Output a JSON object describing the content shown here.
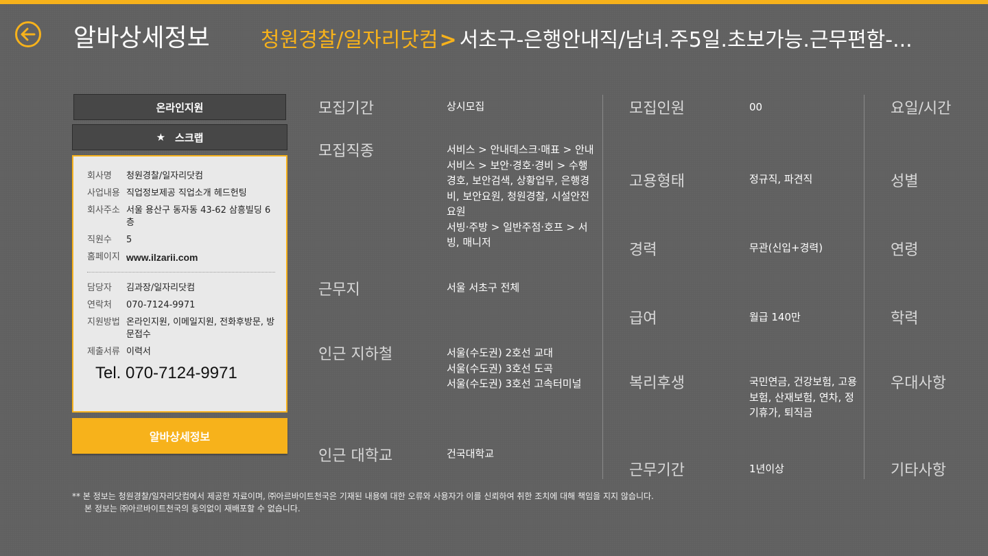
{
  "header": {
    "title": "알바상세정보",
    "company": "청원경찰/일자리닷컴",
    "job_title": "서초구-은행안내직/남녀.주5일.초보가능.근무편함-..."
  },
  "sidebar": {
    "apply_label": "온라인지원",
    "scrap_label": "스크랩",
    "detail_label": "알바상세정보",
    "company_info": [
      {
        "key": "회사명",
        "value": "청원경찰/일자리닷컴"
      },
      {
        "key": "사업내용",
        "value": "직업정보제공 직업소개 헤드헌팅"
      },
      {
        "key": "회사주소",
        "value": "서울 용산구 동자동 43-62 삼흥빌딩 6층"
      },
      {
        "key": "직원수",
        "value": "5"
      },
      {
        "key": "홈페이지",
        "value": "www.ilzarii.com"
      }
    ],
    "contact_info": [
      {
        "key": "담당자",
        "value": "김과장/일자리닷컴"
      },
      {
        "key": "연락처",
        "value": "070-7124-9971"
      },
      {
        "key": "지원방법",
        "value": "온라인지원, 이메일지원, 전화후방문, 방문접수"
      },
      {
        "key": "제출서류",
        "value": "이력서"
      }
    ],
    "tel": "Tel. 070-7124-9971"
  },
  "details": {
    "col1": [
      {
        "label": "모집기간",
        "value": "상시모집"
      },
      {
        "label": "모집직종",
        "value": "서비스 > 안내데스크·매표 > 안내\n서비스 > 보안·경호·경비 > 수행경호, 보안검색, 상황업무, 은행경비, 보안요원, 청원경찰, 시설안전요원\n서빙·주방 > 일반주점·호프 > 서빙, 매니저"
      },
      {
        "label": "근무지",
        "value": "서울 서초구 전체"
      },
      {
        "label": "인근 지하철",
        "value": "서울(수도권) 2호선 교대\n서울(수도권) 3호선 도곡\n서울(수도권) 3호선 고속터미널"
      },
      {
        "label": "인근 대학교",
        "value": "건국대학교"
      }
    ],
    "col2": [
      {
        "label": "모집인원",
        "value": "00"
      },
      {
        "label": "고용형태",
        "value": "정규직, 파견직"
      },
      {
        "label": "경력",
        "value": "무관(신입+경력)"
      },
      {
        "label": "급여",
        "value": "월급 140만"
      },
      {
        "label": "복리후생",
        "value": "국민연금, 건강보험, 고용보험, 산재보험, 연차, 정기휴가, 퇴직금"
      },
      {
        "label": "근무기간",
        "value": "1년이상"
      }
    ],
    "col3": [
      {
        "label": "요일/시간"
      },
      {
        "label": "성별"
      },
      {
        "label": "연령"
      },
      {
        "label": "학력"
      },
      {
        "label": "우대사항"
      },
      {
        "label": "기타사항"
      }
    ]
  },
  "footer": {
    "line1": "** 본 정보는 청원경찰/일자리닷컴에서 제공한 자료이며, ㈜아르바이트천국은 기재된 내용에 대한 오류와 사용자가 이를 신뢰하여 취한 조치에 대해 책임을 지지 않습니다.",
    "line2": "본 정보는 ㈜아르바이트천국의 동의없이 재배포할 수 없습니다."
  },
  "colors": {
    "accent": "#f7b21b",
    "background": "#606060",
    "card": "#e9e9e9"
  },
  "icons": {
    "back": "arrow-left-circle-icon",
    "scrap": "star-icon"
  }
}
